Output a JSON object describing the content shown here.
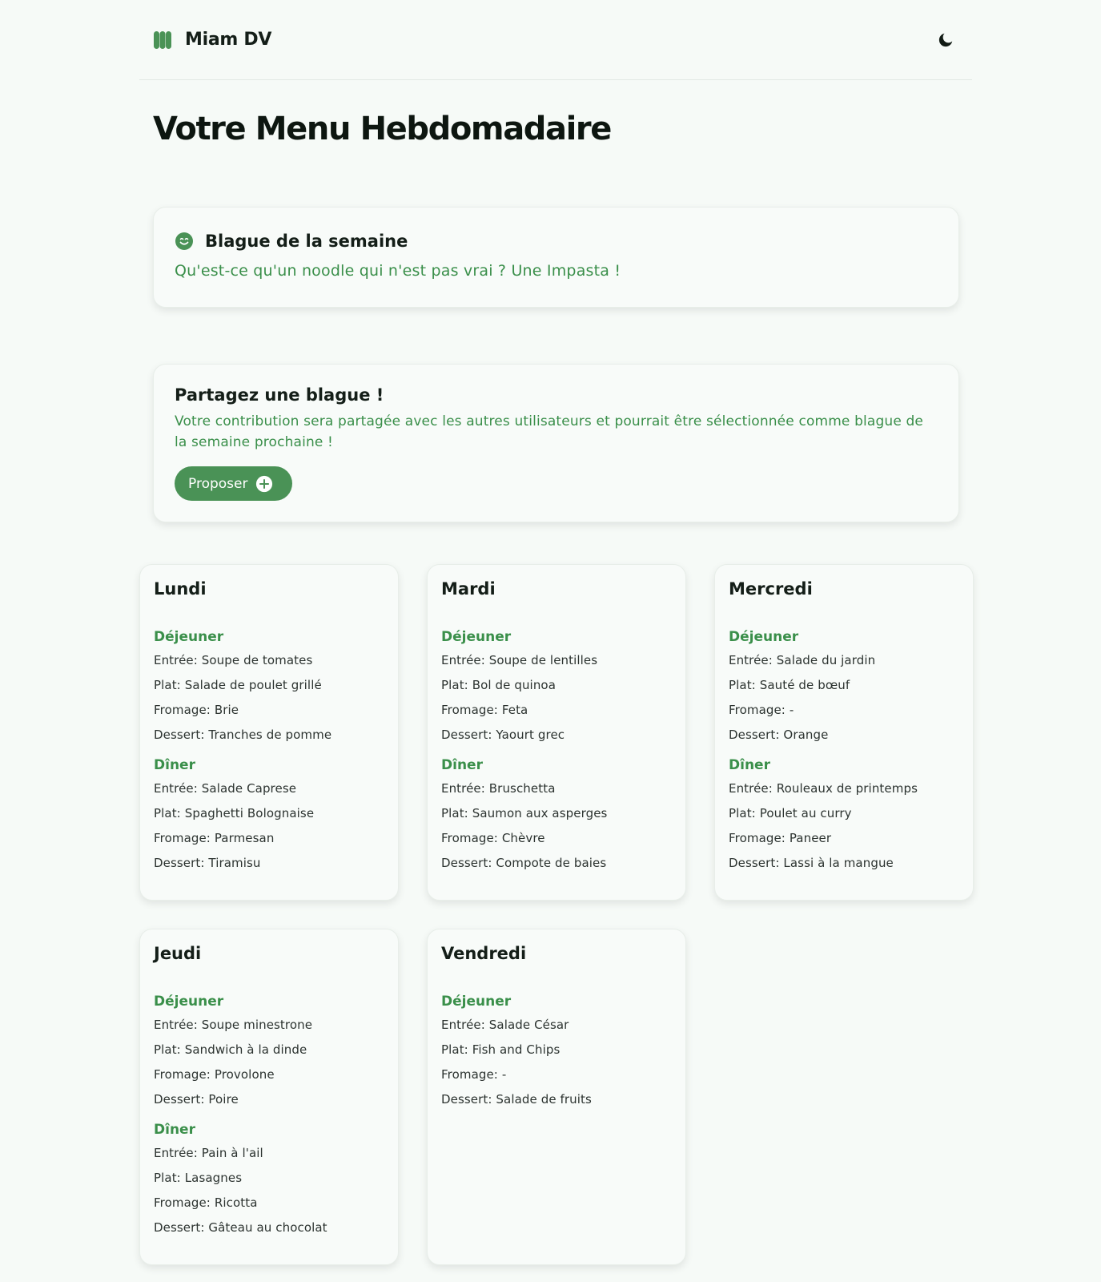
{
  "app": {
    "name": "Miam DV",
    "accent": "#4a9256"
  },
  "page_title": "Votre Menu Hebdomadaire",
  "joke": {
    "title": "Blague de la semaine",
    "text": "Qu'est-ce qu'un noodle qui n'est pas vrai ? Une Impasta !",
    "icon": "smile-icon"
  },
  "share": {
    "title": "Partagez une blague !",
    "text": "Votre contribution sera partagée avec les autres utilisateurs et pourrait être sélectionnée comme blague de la semaine prochaine !",
    "button_label": "Proposer",
    "button_icon": "plus-circle-icon"
  },
  "days": [
    {
      "name": "Lundi",
      "meals": [
        {
          "title": "Déjeuner",
          "lines": [
            "Entrée: Soupe de tomates",
            "Plat: Salade de poulet grillé",
            "Fromage: Brie",
            "Dessert: Tranches de pomme"
          ]
        },
        {
          "title": "Dîner",
          "lines": [
            "Entrée: Salade Caprese",
            "Plat: Spaghetti Bolognaise",
            "Fromage: Parmesan",
            "Dessert: Tiramisu"
          ]
        }
      ]
    },
    {
      "name": "Mardi",
      "meals": [
        {
          "title": "Déjeuner",
          "lines": [
            "Entrée: Soupe de lentilles",
            "Plat: Bol de quinoa",
            "Fromage: Feta",
            "Dessert: Yaourt grec"
          ]
        },
        {
          "title": "Dîner",
          "lines": [
            "Entrée: Bruschetta",
            "Plat: Saumon aux asperges",
            "Fromage: Chèvre",
            "Dessert: Compote de baies"
          ]
        }
      ]
    },
    {
      "name": "Mercredi",
      "meals": [
        {
          "title": "Déjeuner",
          "lines": [
            "Entrée: Salade du jardin",
            "Plat: Sauté de bœuf",
            "Fromage: -",
            "Dessert: Orange"
          ]
        },
        {
          "title": "Dîner",
          "lines": [
            "Entrée: Rouleaux de printemps",
            "Plat: Poulet au curry",
            "Fromage: Paneer",
            "Dessert: Lassi à la mangue"
          ]
        }
      ]
    },
    {
      "name": "Jeudi",
      "meals": [
        {
          "title": "Déjeuner",
          "lines": [
            "Entrée: Soupe minestrone",
            "Plat: Sandwich à la dinde",
            "Fromage: Provolone",
            "Dessert: Poire"
          ]
        },
        {
          "title": "Dîner",
          "lines": [
            "Entrée: Pain à l'ail",
            "Plat: Lasagnes",
            "Fromage: Ricotta",
            "Dessert: Gâteau au chocolat"
          ]
        }
      ]
    },
    {
      "name": "Vendredi",
      "meals": [
        {
          "title": "Déjeuner",
          "lines": [
            "Entrée: Salade César",
            "Plat: Fish and Chips",
            "Fromage: -",
            "Dessert: Salade de fruits"
          ]
        }
      ]
    }
  ]
}
